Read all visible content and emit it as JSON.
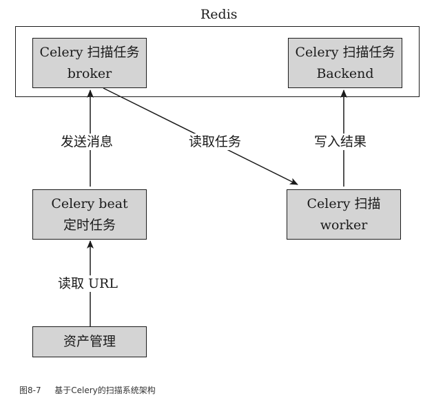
{
  "diagram": {
    "redis_container": {
      "title": "Redis"
    },
    "nodes": {
      "broker": {
        "line1": "Celery 扫描任务",
        "line2": "broker"
      },
      "backend": {
        "line1": "Celery 扫描任务",
        "line2": "Backend"
      },
      "beat": {
        "line1": "Celery beat",
        "line2": "定时任务"
      },
      "worker": {
        "line1": "Celery 扫描",
        "line2": "worker"
      },
      "asset": {
        "line1": "资产管理"
      }
    },
    "edges": {
      "send_message": "发送消息",
      "read_task": "读取任务",
      "write_result": "写入结果",
      "read_url": "读取 URL"
    }
  },
  "caption": {
    "figure": "图8-7",
    "text": "基于Celery的扫描系统架构"
  }
}
